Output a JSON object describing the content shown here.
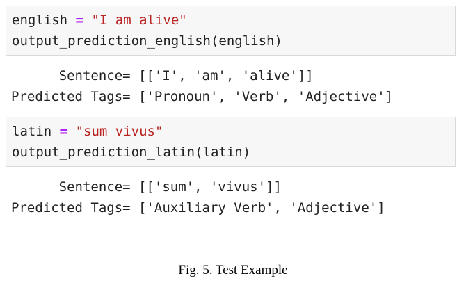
{
  "cells": [
    {
      "code_line1": {
        "var": "english",
        "op": "=",
        "str": "\"I am alive\""
      },
      "code_line2": "output_prediction_english(english)",
      "output_line1": "      Sentence= [['I', 'am', 'alive']]",
      "output_line2": "Predicted Tags= ['Pronoun', 'Verb', 'Adjective']"
    },
    {
      "code_line1": {
        "var": "latin",
        "op": "=",
        "str": "\"sum vivus\""
      },
      "code_line2": "output_prediction_latin(latin)",
      "output_line1": "      Sentence= [['sum', 'vivus']]",
      "output_line2": "Predicted Tags= ['Auxiliary Verb', 'Adjective']"
    }
  ],
  "caption": "Fig. 5.  Test Example",
  "colors": {
    "operator": "#aa22ff",
    "string": "#ba2121",
    "code_background": "#f7f7f7"
  }
}
